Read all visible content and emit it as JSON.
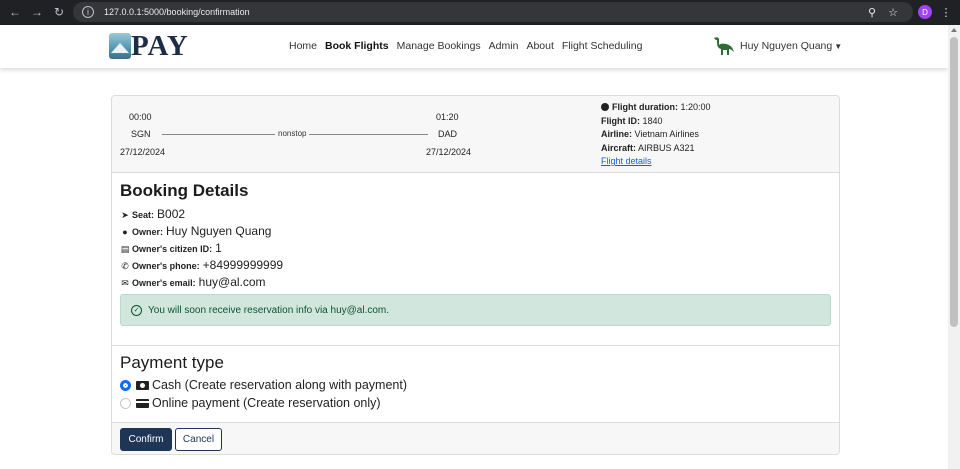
{
  "browser": {
    "url": "127.0.0.1:5000/booking/confirmation",
    "profile_initial": "D"
  },
  "nav": {
    "logo_text": "PAY",
    "menu": [
      "Home",
      "Book Flights",
      "Manage Bookings",
      "Admin",
      "About",
      "Flight Scheduling"
    ],
    "active": "Book Flights",
    "user_name": "Huy Nguyen Quang"
  },
  "flight": {
    "depart_time": "00:00",
    "arrive_time": "01:20",
    "from": "SGN",
    "to": "DAD",
    "route_label": "nonstop",
    "depart_date": "27/12/2024",
    "arrive_date": "27/12/2024",
    "duration_label": "Flight duration:",
    "duration": "1:20:00",
    "id_label": "Flight ID:",
    "id": "1840",
    "airline_label": "Airline:",
    "airline": "Vietnam Airlines",
    "aircraft_label": "Aircraft:",
    "aircraft": "AIRBUS A321",
    "details_link": "Flight details"
  },
  "booking": {
    "title": "Booking Details",
    "seat_label": "Seat:",
    "seat": "B002",
    "owner_label": "Owner:",
    "owner": "Huy Nguyen Quang",
    "citizen_label": "Owner's citizen ID:",
    "citizen": "1",
    "phone_label": "Owner's phone:",
    "phone": "+84999999999",
    "email_label": "Owner's email:",
    "email": "huy@al.com",
    "alert": "You will soon receive reservation info via huy@al.com."
  },
  "payment": {
    "title": "Payment type",
    "cash_label": "Cash (Create reservation along with payment)",
    "online_label": "Online payment (Create reservation only)",
    "selected": "cash"
  },
  "actions": {
    "confirm": "Confirm",
    "cancel": "Cancel"
  },
  "colors": {
    "primary": "#1f3556",
    "radio": "#0d6efd",
    "alert_bg": "#d1e7dd",
    "alert_text": "#0f5132",
    "link": "#1a5fd6"
  }
}
